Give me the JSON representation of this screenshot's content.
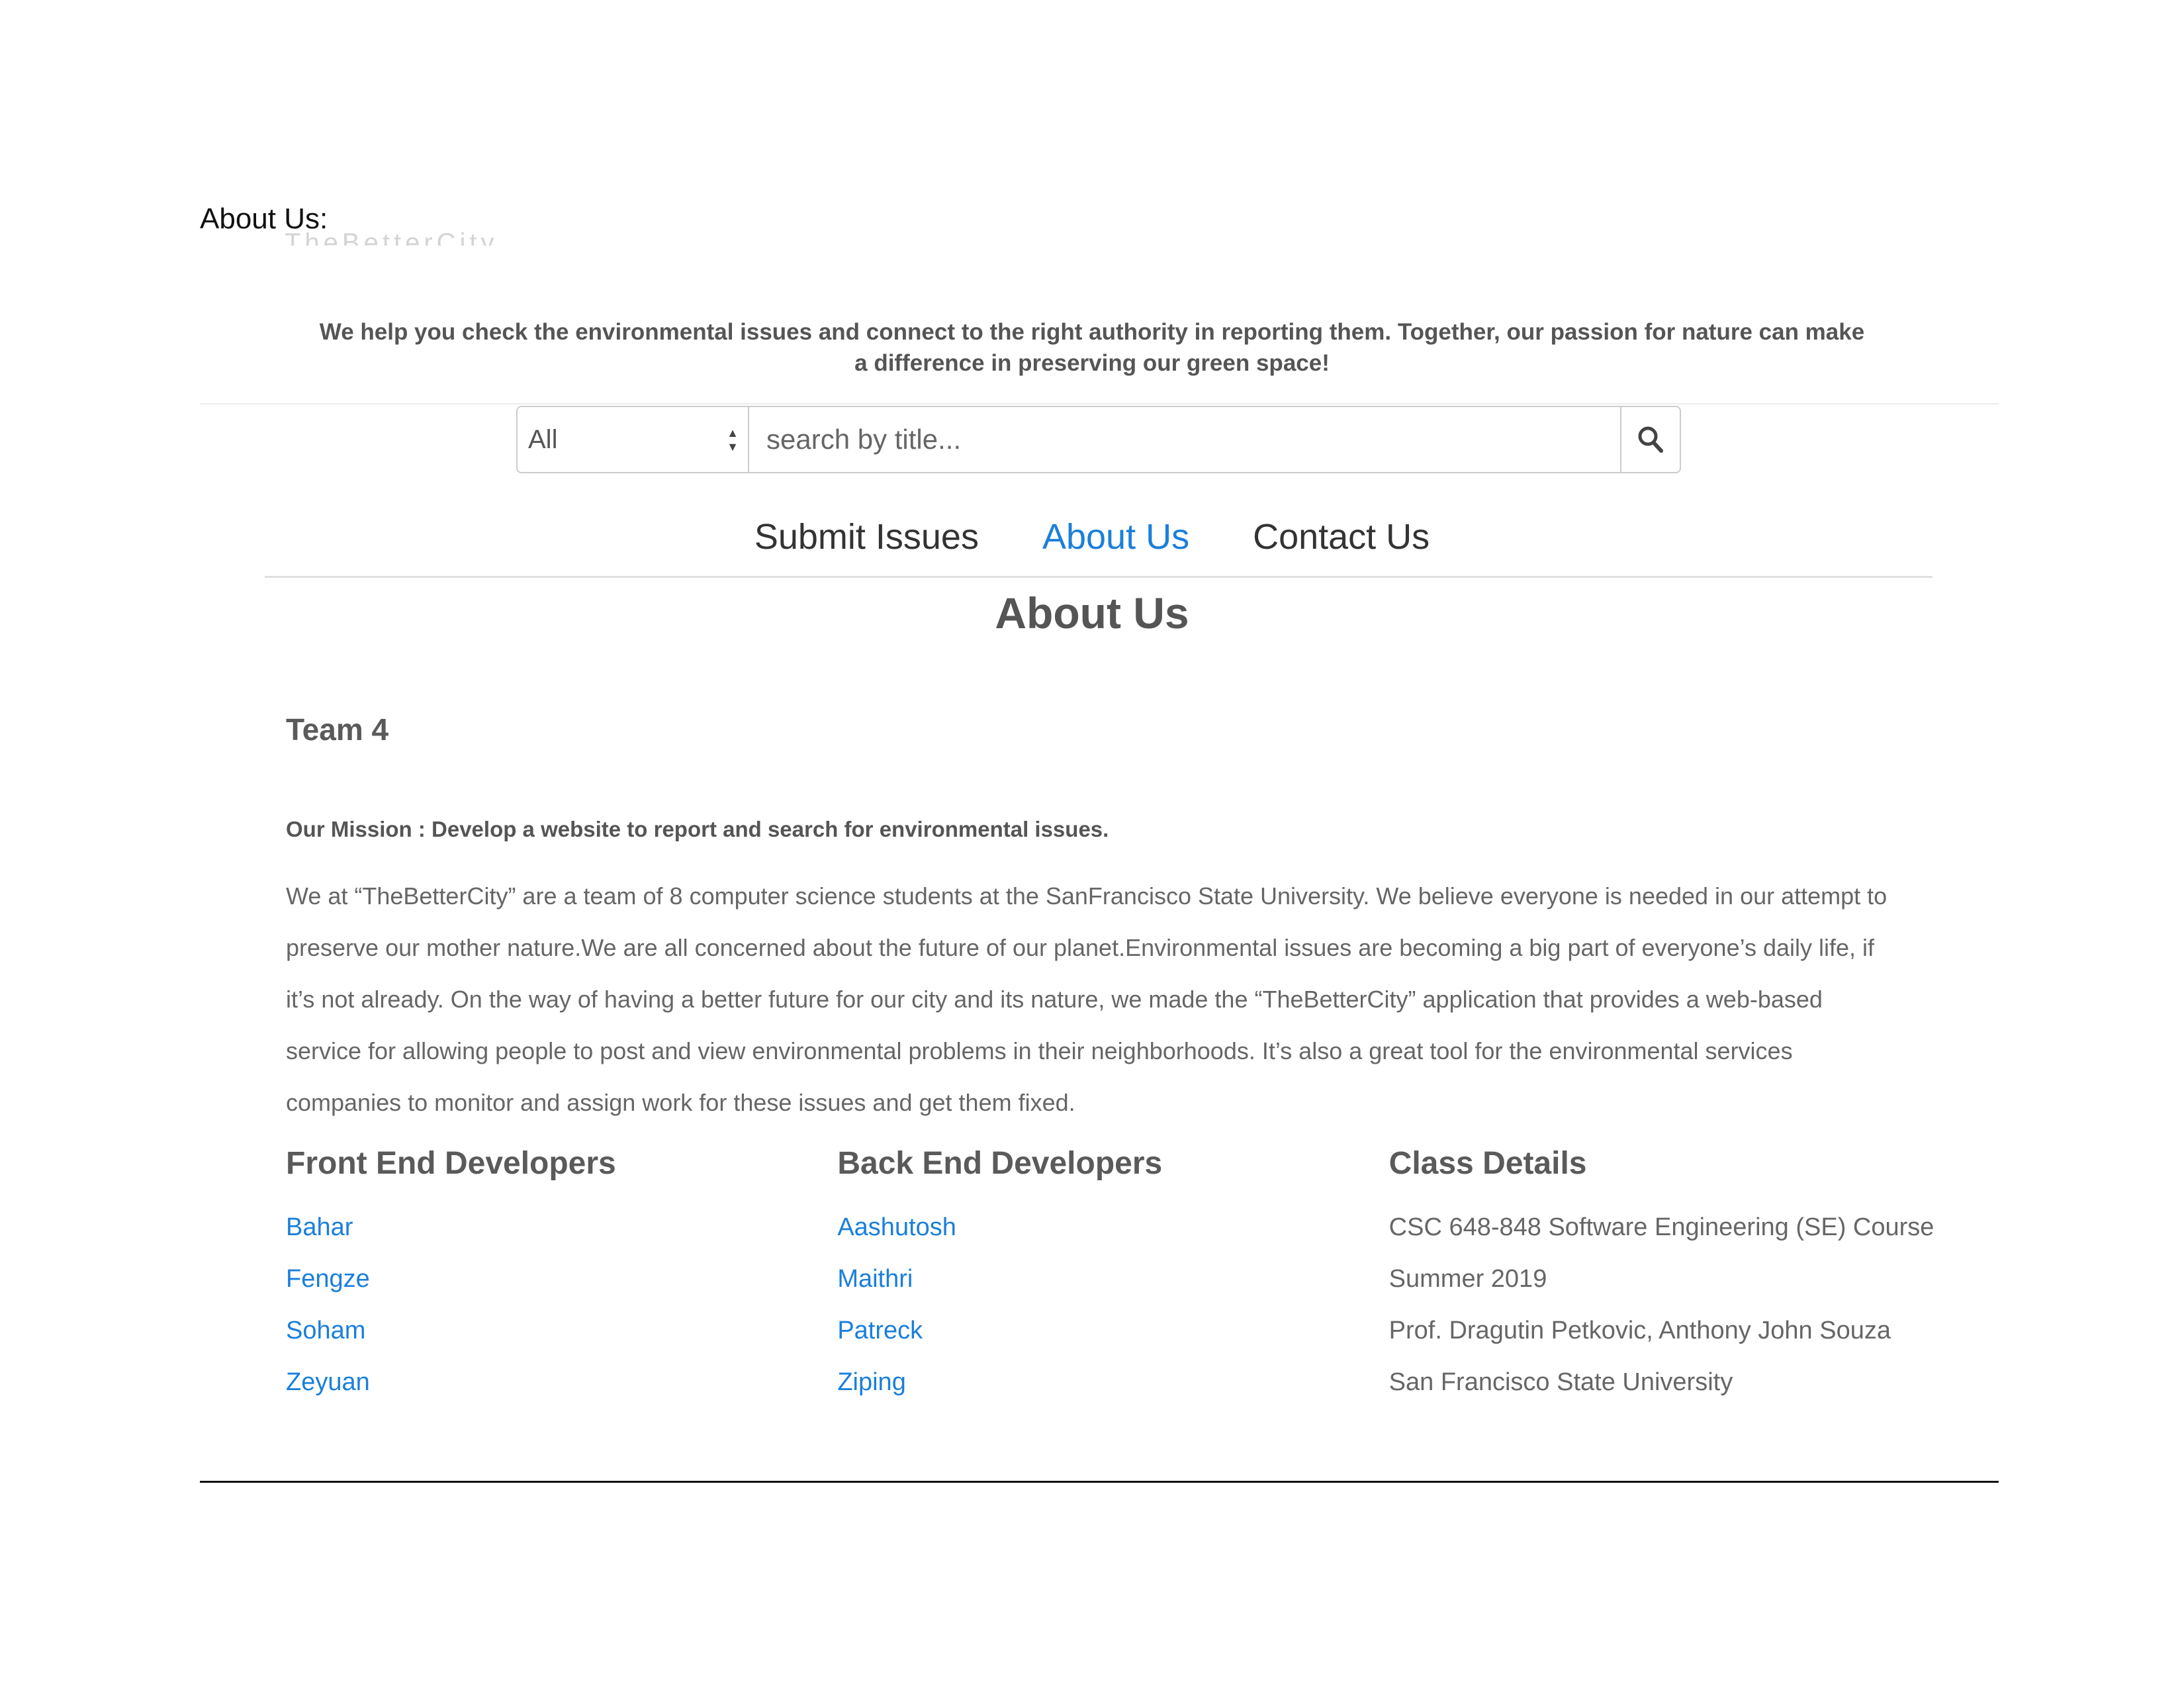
{
  "document": {
    "label": "About Us:",
    "faded_heading": "TheBetterCity"
  },
  "header": {
    "tagline": "We help you check the environmental issues and connect to the right authority in reporting them. Together, our passion for nature can make a difference in preserving our green space!"
  },
  "search": {
    "category_selected": "All",
    "placeholder": "search by title..."
  },
  "nav": {
    "items": [
      {
        "label": "Submit Issues",
        "active": false
      },
      {
        "label": "About Us",
        "active": true
      },
      {
        "label": "Contact Us",
        "active": false
      }
    ]
  },
  "main": {
    "title": "About Us",
    "team": "Team 4",
    "mission": "Our Mission : Develop a website to report and search for environmental issues.",
    "description": "We at “TheBetterCity” are a team of 8 computer science students at the SanFrancisco State University. We believe everyone is needed in our attempt to preserve our mother nature.We are all concerned about the future of our planet.Environmental issues are becoming a big part of everyone’s daily life, if it’s not already. On the way of having a better future for our city and its nature, we made the “TheBetterCity” application that provides a web-based service for allowing people to post and view environmental problems in their neighborhoods. It’s also a great tool for the environmental services companies to monitor and assign work for these issues and get them fixed."
  },
  "front_end": {
    "title": "Front End Developers",
    "members": [
      "Bahar",
      "Fengze",
      "Soham",
      "Zeyuan"
    ]
  },
  "back_end": {
    "title": "Back End Developers",
    "members": [
      "Aashutosh",
      "Maithri",
      "Patreck",
      "Ziping"
    ]
  },
  "class_details": {
    "title": "Class Details",
    "items": [
      "CSC 648-848 Software Engineering (SE) Course",
      "Summer 2019",
      "Prof. Dragutin Petkovic, Anthony John Souza",
      "San Francisco State University"
    ]
  },
  "colors": {
    "link": "#1a7fdb",
    "heading": "#5a5a5a",
    "body_text": "#666666"
  }
}
